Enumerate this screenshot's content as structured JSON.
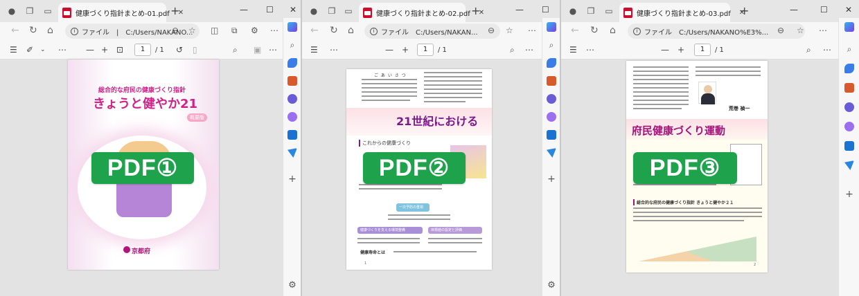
{
  "windows": [
    {
      "tab_title": "健康づくり指針まとめ-01.pdf",
      "address": "ファイル　|　C:/Users/NAKANO...",
      "page_number": "1",
      "page_total": "/ 1",
      "overlay_label": "PDF①",
      "doc": {
        "subtitle": "総合的な府民の健康づくり指針",
        "title": "きょうと健やか21",
        "badge": "概要版",
        "publisher": "京都府"
      }
    },
    {
      "tab_title": "健康づくり指針まとめ-02.pdf",
      "address": "ファイル　C:/Users/NAKAN...",
      "page_number": "1",
      "page_total": "/ 1",
      "overlay_label": "PDF②",
      "doc": {
        "greeting": "ご あ い さ つ",
        "heading": "21世紀における",
        "section": "これからの健康づくり",
        "box1": "一次予防の重視",
        "box2": "健康づくりを支える環境整備",
        "box3": "目標値の設定と評価",
        "footer": "健康寿命とは",
        "page_num": "1"
      }
    },
    {
      "tab_title": "健康づくり指針まとめ-03.pdf",
      "address": "ファイル　C:/Users/NAKANO%E3%...",
      "page_number": "1",
      "page_total": "/ 1",
      "overlay_label": "PDF③",
      "doc": {
        "signature": "荒巻 禎一",
        "heading": "府民健康づくり運動",
        "section": "総合的な府民の健康づくり指針 きょうと健やか２１",
        "page_num": "2"
      }
    }
  ],
  "colors": {
    "pdf_label_bg": "#1fa24c",
    "pdf_icon": "#c8102e",
    "title_magenta": "#d0208a",
    "heading_purple": "#7b1a8a"
  },
  "icons": {
    "nav": [
      "back-icon",
      "refresh-icon",
      "home-icon"
    ],
    "sidebar": [
      "search-icon",
      "tag-icon",
      "briefcase-icon",
      "people-icon",
      "copilot-icon",
      "outlook-icon",
      "send-icon",
      "plus-icon",
      "settings-icon"
    ]
  }
}
